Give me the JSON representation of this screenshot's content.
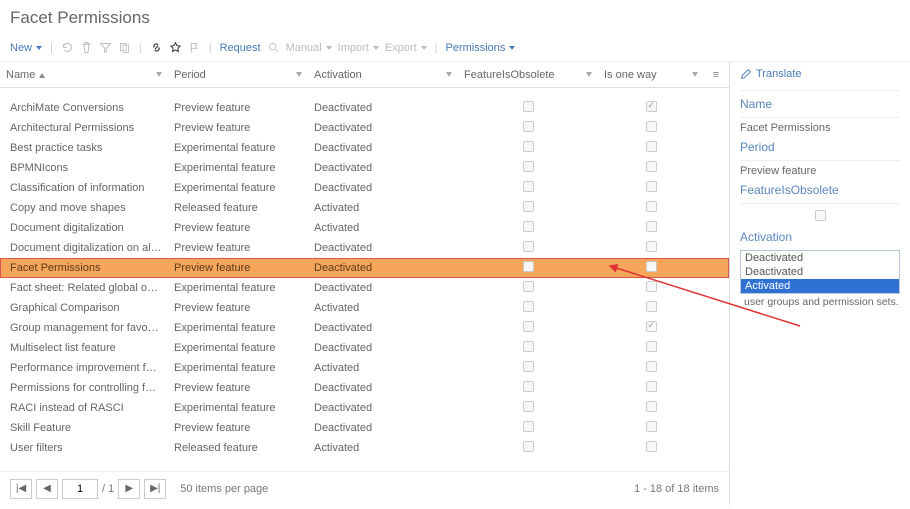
{
  "title": "Facet Permissions",
  "toolbar": {
    "new": "New",
    "request": "Request",
    "manual": "Manual",
    "import": "Import",
    "export": "Export",
    "permissions": "Permissions"
  },
  "columns": {
    "name": "Name",
    "period": "Period",
    "activation": "Activation",
    "obsolete": "FeatureIsObsolete",
    "oneway": "Is one way"
  },
  "rows": [
    {
      "name": "ArchiMate Conversions",
      "period": "Preview feature",
      "activation": "Deactivated",
      "obsolete": false,
      "oneway": true
    },
    {
      "name": "Architectural Permissions",
      "period": "Preview feature",
      "activation": "Deactivated",
      "obsolete": false,
      "oneway": false
    },
    {
      "name": "Best practice tasks",
      "period": "Experimental feature",
      "activation": "Deactivated",
      "obsolete": false,
      "oneway": false
    },
    {
      "name": "BPMNIcons",
      "period": "Experimental feature",
      "activation": "Deactivated",
      "obsolete": false,
      "oneway": false
    },
    {
      "name": "Classification of information",
      "period": "Experimental feature",
      "activation": "Deactivated",
      "obsolete": false,
      "oneway": false
    },
    {
      "name": "Copy and move shapes",
      "period": "Released feature",
      "activation": "Activated",
      "obsolete": false,
      "oneway": false
    },
    {
      "name": "Document digitalization",
      "period": "Preview feature",
      "activation": "Activated",
      "obsolete": false,
      "oneway": false
    },
    {
      "name": "Document digitalization on all facets",
      "period": "Preview feature",
      "activation": "Deactivated",
      "obsolete": false,
      "oneway": false
    },
    {
      "name": "Facet Permissions",
      "period": "Preview feature",
      "activation": "Deactivated",
      "obsolete": false,
      "oneway": false,
      "selected": true
    },
    {
      "name": "Fact sheet: Related global objects",
      "period": "Experimental feature",
      "activation": "Deactivated",
      "obsolete": false,
      "oneway": false
    },
    {
      "name": "Graphical Comparison",
      "period": "Preview feature",
      "activation": "Activated",
      "obsolete": false,
      "oneway": false
    },
    {
      "name": "Group management for favorites",
      "period": "Experimental feature",
      "activation": "Deactivated",
      "obsolete": false,
      "oneway": true
    },
    {
      "name": "Multiselect list feature",
      "period": "Experimental feature",
      "activation": "Deactivated",
      "obsolete": false,
      "oneway": false
    },
    {
      "name": "Performance improvement for mode...",
      "period": "Experimental feature",
      "activation": "Activated",
      "obsolete": false,
      "oneway": false
    },
    {
      "name": "Permissions for controlling favorites",
      "period": "Preview feature",
      "activation": "Deactivated",
      "obsolete": false,
      "oneway": false
    },
    {
      "name": "RACI instead of RASCI",
      "period": "Experimental feature",
      "activation": "Deactivated",
      "obsolete": false,
      "oneway": false
    },
    {
      "name": "Skill Feature",
      "period": "Preview feature",
      "activation": "Deactivated",
      "obsolete": false,
      "oneway": false
    },
    {
      "name": "User filters",
      "period": "Released feature",
      "activation": "Activated",
      "obsolete": false,
      "oneway": false
    }
  ],
  "pager": {
    "page": "1",
    "total_pages": "/ 1",
    "per_page": "50  items per page",
    "count": "1 - 18 of 18 items"
  },
  "side": {
    "translate": "Translate",
    "name_label": "Name",
    "name_value": "Facet Permissions",
    "period_label": "Period",
    "period_value": "Preview feature",
    "obsolete_label": "FeatureIsObsolete",
    "activation_label": "Activation",
    "options": [
      "Deactivated",
      "Deactivated",
      "Activated"
    ],
    "selected_option_index": 2,
    "hint": "user groups and permission sets."
  }
}
